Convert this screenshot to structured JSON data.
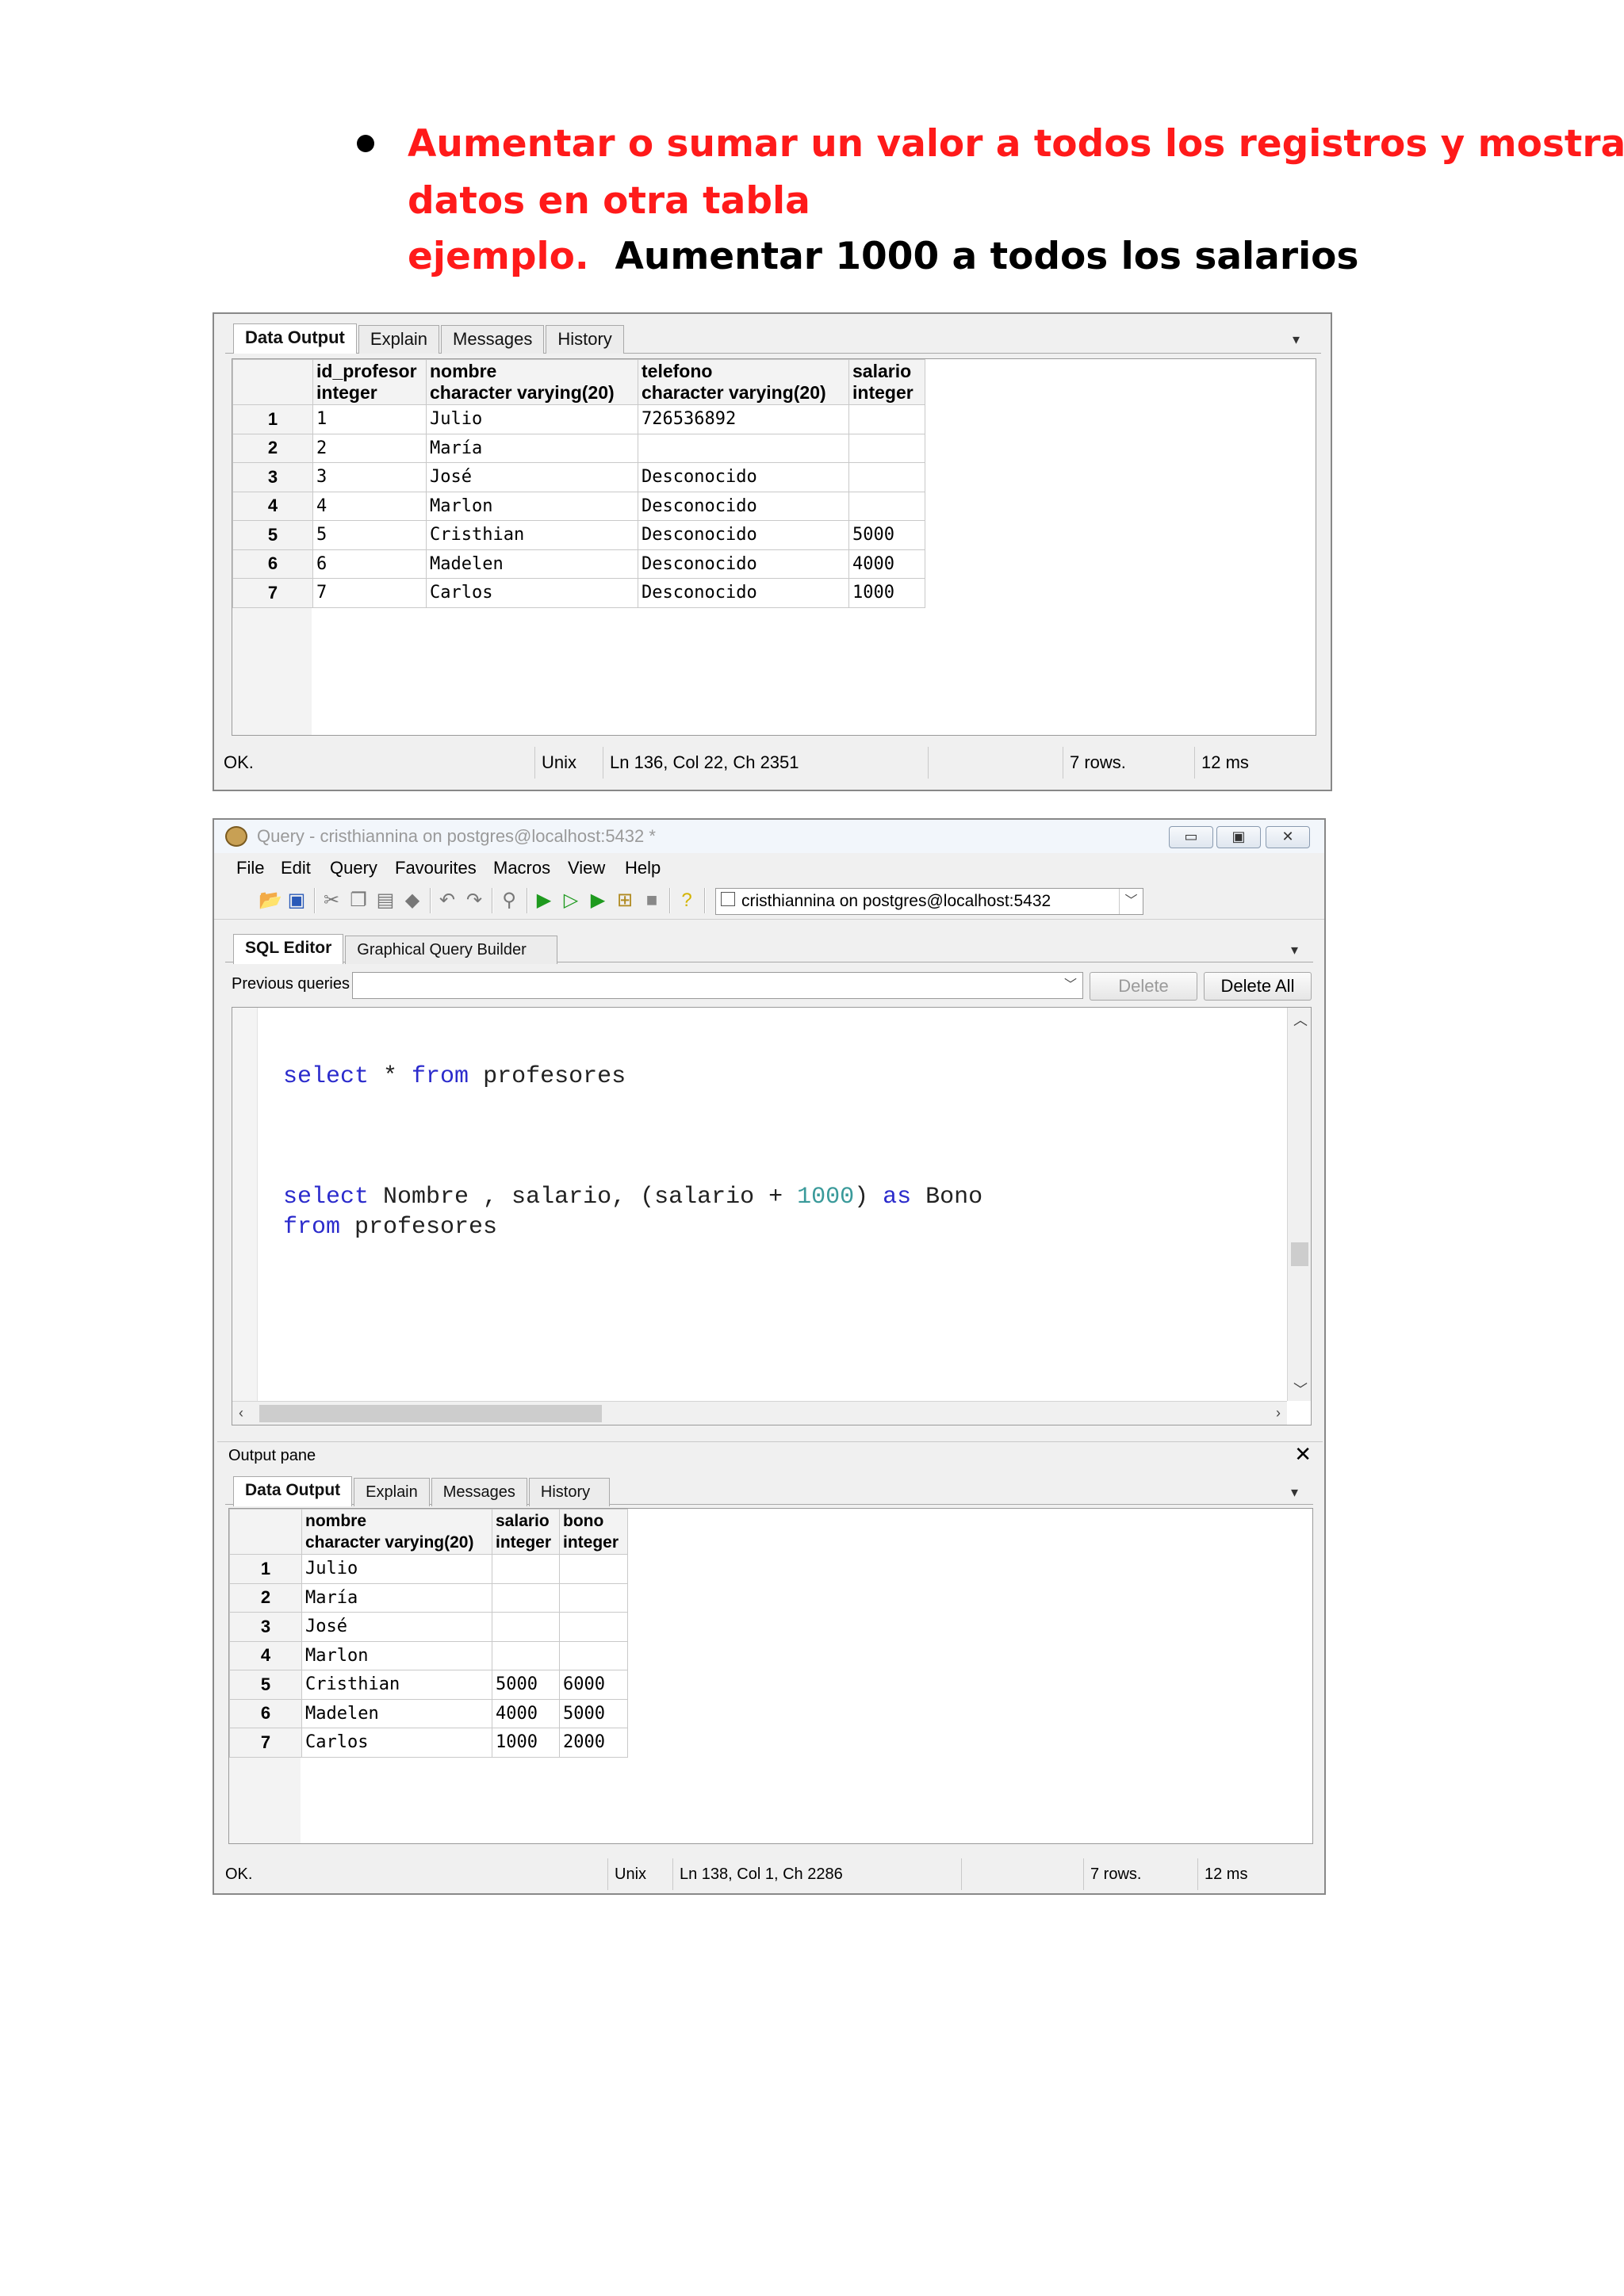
{
  "heading": {
    "line1": "Aumentar o sumar un valor a todos los registros y mostrar",
    "line2": "datos en otra tabla",
    "line3_red": "ejemplo.",
    "line3_black": "Aumentar 1000 a todos los salarios"
  },
  "result1": {
    "tabs": [
      "Data Output",
      "Explain",
      "Messages",
      "History"
    ],
    "columns": [
      {
        "name": "id_profesor",
        "type": "integer"
      },
      {
        "name": "nombre",
        "type": "character varying(20)"
      },
      {
        "name": "telefono",
        "type": "character varying(20)"
      },
      {
        "name": "salario",
        "type": "integer"
      }
    ],
    "rows": [
      [
        "1",
        "1",
        "Julio",
        "726536892",
        ""
      ],
      [
        "2",
        "2",
        "María",
        "",
        ""
      ],
      [
        "3",
        "3",
        "José",
        "Desconocido",
        ""
      ],
      [
        "4",
        "4",
        "Marlon",
        "Desconocido",
        ""
      ],
      [
        "5",
        "5",
        "Cristhian",
        "Desconocido",
        "5000"
      ],
      [
        "6",
        "6",
        "Madelen",
        "Desconocido",
        "4000"
      ],
      [
        "7",
        "7",
        "Carlos",
        "Desconocido",
        "1000"
      ]
    ],
    "status": {
      "state": "OK.",
      "eol": "Unix",
      "position": "Ln 136, Col 22, Ch 2351",
      "rows": "7 rows.",
      "time": "12 ms"
    }
  },
  "query_window": {
    "title": "Query - cristhiannina on postgres@localhost:5432 *",
    "menu": [
      "File",
      "Edit",
      "Query",
      "Favourites",
      "Macros",
      "View",
      "Help"
    ],
    "connection": "cristhiannina on postgres@localhost:5432",
    "editor_tabs": [
      "SQL Editor",
      "Graphical Query Builder"
    ],
    "previous_queries_label": "Previous queries",
    "delete_label": "Delete",
    "delete_all_label": "Delete All",
    "code": {
      "q1_select": "select",
      "q1_rest": " * ",
      "q1_from": "from",
      "q1_table": " profesores",
      "q2_select": "select",
      "q2_cols": " Nombre , salario, (salario + ",
      "q2_num": "1000",
      "q2_close": ") ",
      "q2_as": "as",
      "q2_alias": " Bono",
      "q3_from": "from",
      "q3_table": " profesores"
    },
    "output_pane_label": "Output pane",
    "output_tabs": [
      "Data Output",
      "Explain",
      "Messages",
      "History"
    ],
    "columns": [
      {
        "name": "nombre",
        "type": "character varying(20)"
      },
      {
        "name": "salario",
        "type": "integer"
      },
      {
        "name": "bono",
        "type": "integer"
      }
    ],
    "rows": [
      [
        "1",
        "Julio",
        "",
        ""
      ],
      [
        "2",
        "María",
        "",
        ""
      ],
      [
        "3",
        "José",
        "",
        ""
      ],
      [
        "4",
        "Marlon",
        "",
        ""
      ],
      [
        "5",
        "Cristhian",
        "5000",
        "6000"
      ],
      [
        "6",
        "Madelen",
        "4000",
        "5000"
      ],
      [
        "7",
        "Carlos",
        "1000",
        "2000"
      ]
    ],
    "status": {
      "state": "OK.",
      "eol": "Unix",
      "position": "Ln 138, Col 1, Ch 2286",
      "rows": "7 rows.",
      "time": "12 ms"
    }
  },
  "colors": {
    "heading_red": "#ff1a1a",
    "keyword_blue": "#2b2bcc",
    "number_teal": "#3a9a9a"
  }
}
